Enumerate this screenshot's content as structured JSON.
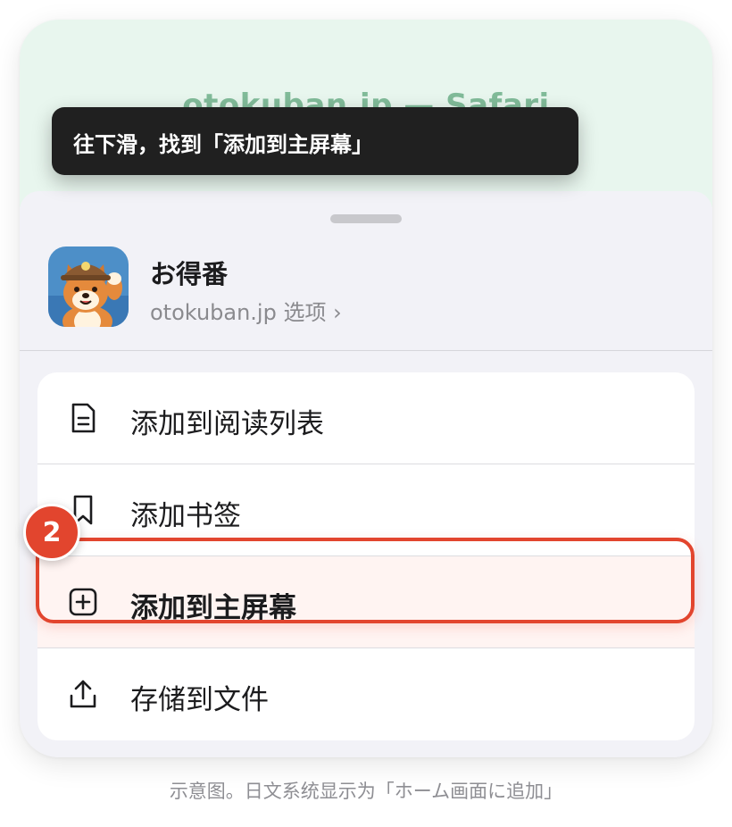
{
  "safari": {
    "title": "otokuban.jp — Safari"
  },
  "toast": {
    "text": "往下滑，找到「添加到主屏幕」"
  },
  "app": {
    "name": "お得番",
    "subtitle": "otokuban.jp 选项 ›",
    "icon": "shiba-dog-app-icon"
  },
  "menu": {
    "items": [
      {
        "label": "添加到阅读列表",
        "icon": "reading-list-icon"
      },
      {
        "label": "添加书签",
        "icon": "bookmark-icon"
      },
      {
        "label": "添加到主屏幕",
        "icon": "add-square-icon",
        "highlighted": true
      },
      {
        "label": "存储到文件",
        "icon": "share-upload-icon"
      }
    ]
  },
  "step_badge": {
    "number": "2"
  },
  "caption": {
    "text": "示意图。日文系统显示为「ホーム画面に追加」"
  },
  "colors": {
    "accent": "#e2452e",
    "safari_bg": "#e8f6ee",
    "toast_bg": "#202020"
  }
}
